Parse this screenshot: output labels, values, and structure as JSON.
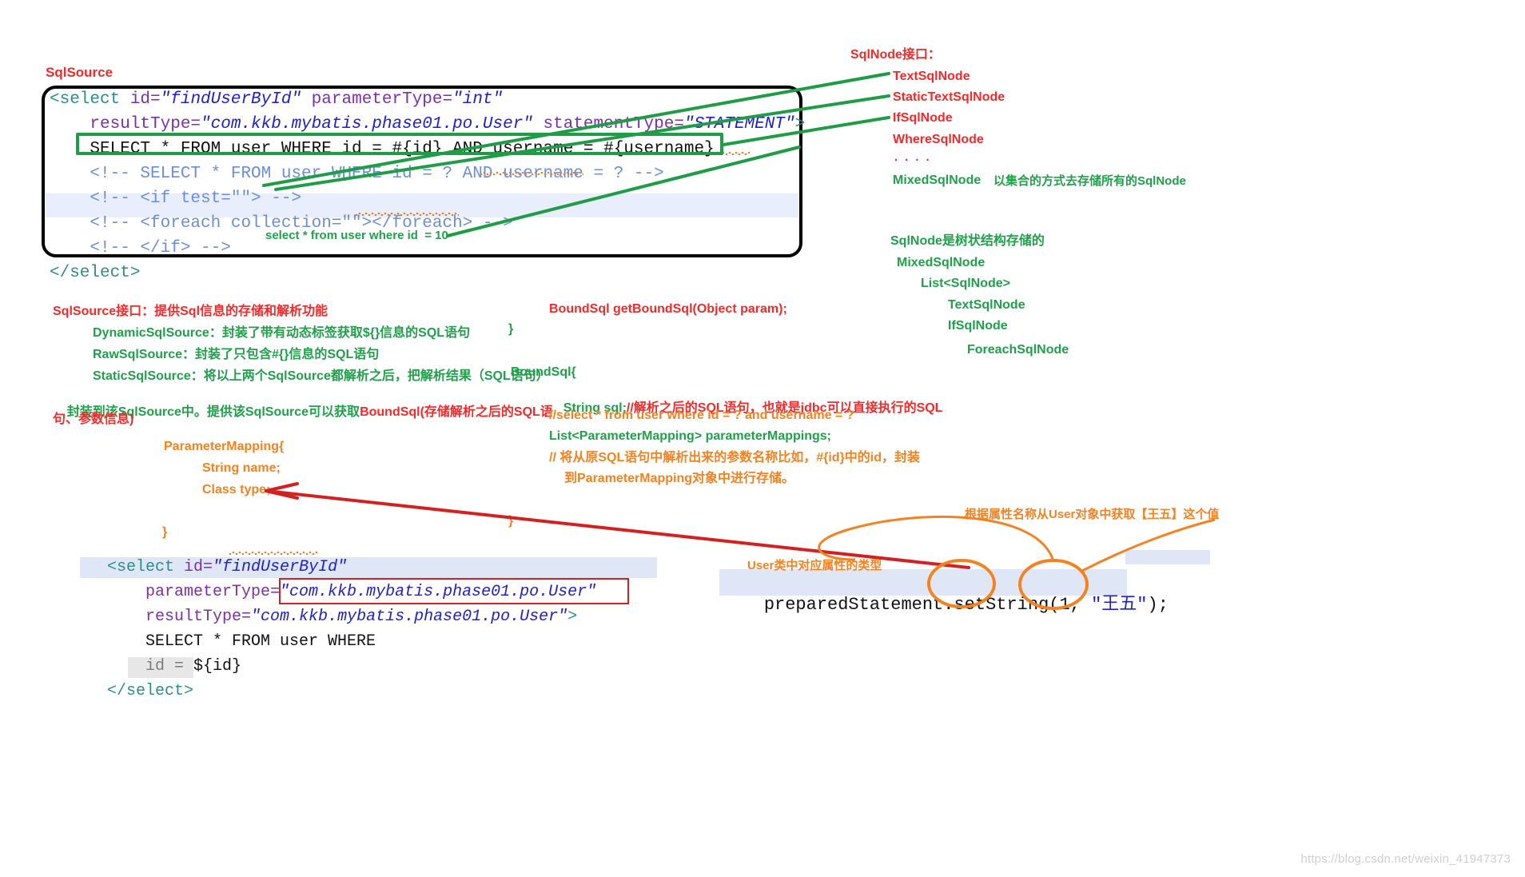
{
  "labels": {
    "sql_source_title": "SqlSource",
    "sqlnode_interface_title": "SqlNode接口：",
    "sqlnode_items": [
      "TextSqlNode",
      "StaticTextSqlNode",
      "IfSqlNode",
      "WhereSqlNode"
    ],
    "ellipsis_dots": "· · · ·",
    "mixed_sql_node": "MixedSqlNode",
    "mixed_sql_node_note": "以集合的方式去存储所有的SqlNode",
    "tree_note": "SqlNode是树状结构存储的",
    "tree_items": [
      "MixedSqlNode",
      "List<SqlNode>",
      "TextSqlNode",
      "IfSqlNode",
      "ForeachSqlNode"
    ],
    "inline_green_note": "select * from user where id  = 10"
  },
  "top_code": {
    "lines": [
      [
        {
          "t": "<select ",
          "c": "kw-tag"
        },
        {
          "t": "id=",
          "c": "kw-attr"
        },
        {
          "t": "\"findUserById\"",
          "c": "kw-str"
        },
        {
          "t": " parameterType=",
          "c": "kw-attr"
        },
        {
          "t": "\"int\"",
          "c": "kw-str"
        }
      ],
      [
        {
          "t": "    resultType=",
          "c": "kw-attr"
        },
        {
          "t": "\"com.kkb.mybatis.phase01.po.User\"",
          "c": "kw-str"
        },
        {
          "t": " statementType=",
          "c": "kw-attr"
        },
        {
          "t": "\"STATEMENT\"",
          "c": "kw-str"
        },
        {
          "t": ">",
          "c": "kw-tag"
        }
      ],
      [
        {
          "t": "    SELECT * FROM user WHERE id = #{id} AND username = #{username}",
          "c": "kw-plain"
        }
      ],
      [
        {
          "t": "    <!-- SELECT * FROM user WHERE id = ? AND username = ? -->",
          "c": "kw-comment"
        }
      ],
      [
        {
          "t": "    <!-- <if test=\"\"> -->",
          "c": "kw-comment"
        }
      ],
      [
        {
          "t": "    <!-- <foreach collection=\"\"></foreach> -->",
          "c": "kw-comment"
        }
      ],
      [
        {
          "t": "    <!-- </if> -->",
          "c": "kw-comment"
        }
      ],
      [
        {
          "t": "</select>",
          "c": "kw-tag"
        }
      ]
    ]
  },
  "left_notes": {
    "sqlsource_interface": "SqlSource接口：提供Sql信息的存储和解析功能",
    "dynamic_sql_source": "DynamicSqlSource：封装了带有动态标签获取${}信息的SQL语句",
    "raw_sql_source": "RawSqlSource：封装了只包含#{}信息的SQL语句",
    "static_sql_source_l1": "StaticSqlSource：将以上两个SqlSource都解析之后，把解析结果（SQL语句）",
    "static_sql_source_l2_green": "封装到该SqlSource中。提供该SqlSource可以获取",
    "static_sql_source_l2_red": "BoundSql(存储解析之后的SQL语",
    "static_sql_source_l3_red": "句、参数信息)"
  },
  "middle_notes": {
    "get_bound_sql": "BoundSql getBoundSql(Object param);",
    "close_brace": "}",
    "bound_sql_open": "BoundSql{",
    "string_sql_decl": "String sql;",
    "string_sql_comment": "//解析之后的SQL语句，也就是jdbc可以直接执行的SQL",
    "sample_sql_comment": "//select * from user where id = ? and username = ?",
    "param_mappings_decl": "List<ParameterMapping> parameterMappings;",
    "param_mappings_comment_l1": "// 将从原SQL语句中解析出来的参数名称比如，#{id}中的id，封装",
    "param_mappings_comment_l2": "到ParameterMapping对象中进行存储。"
  },
  "parameter_mapping": {
    "open": "ParameterMapping{",
    "field_name": "String name;",
    "field_type": "Class type;",
    "close": "}"
  },
  "bottom_code": {
    "lines": [
      [
        {
          "t": "  <select ",
          "c": "kw-green"
        },
        {
          "t": "id=",
          "c": "kw-attr"
        },
        {
          "t": "\"findUserById\"",
          "c": "kw-str"
        }
      ],
      [
        {
          "t": "      parameterType=",
          "c": "kw-attr"
        },
        {
          "t": "\"com.kkb.mybatis.phase01.po.User\"",
          "c": "kw-str"
        }
      ],
      [
        {
          "t": "      resultType=",
          "c": "kw-attr"
        },
        {
          "t": "\"com.kkb.mybatis.phase01.po.User\"",
          "c": "kw-str"
        },
        {
          "t": ">",
          "c": "kw-tag"
        }
      ],
      [
        {
          "t": "      SELECT * FROM user WHERE",
          "c": "kw-plain"
        }
      ],
      [
        {
          "t": "      id = ${id}",
          "c": "kw-plain"
        }
      ],
      [
        {
          "t": "  </select>",
          "c": "kw-green"
        }
      ]
    ]
  },
  "prepared_statement": {
    "full": "preparedStatement.setString(1, \"王五\");",
    "prefix": "preparedStatement.set",
    "method": "String",
    "mid": "(1, ",
    "value": "\"王五\"",
    "suffix": ");"
  },
  "right_orange_notes": {
    "get_value_note": "根据属性名称从User对象中获取【王五】这个值",
    "user_type_note": "User类中对应属性的类型"
  },
  "watermark": "https://blog.csdn.net/weixin_41947373",
  "colors": {
    "red": "#f42a2a",
    "green": "#20a04a",
    "orange": "#f58220",
    "code_string": "#2020cc",
    "code_attr": "#7b2fa8",
    "code_tag": "#2c8c8c",
    "code_comment": "#6a8fd8",
    "highlight_row": "#e8eefb",
    "stroke_green": "#1f9d46",
    "stroke_red": "#d42020",
    "stroke_orange": "#f58220"
  }
}
